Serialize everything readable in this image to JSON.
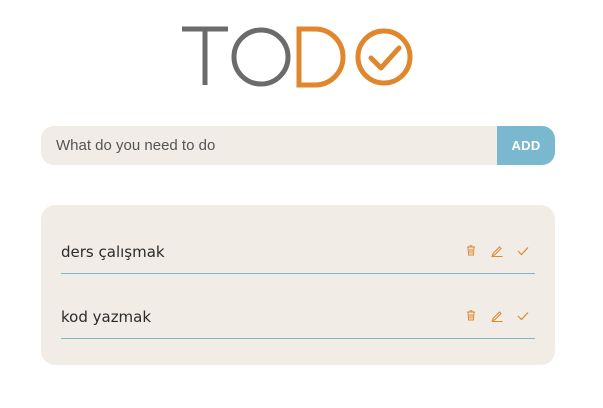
{
  "app": {
    "logo_text": "TODO",
    "accent": "#e0862c",
    "secondary": "#7ab8d0",
    "logo_gray": "#6b6b6b"
  },
  "form": {
    "placeholder": "What do you need to do",
    "value": "",
    "add_label": "ADD"
  },
  "todos": [
    {
      "text": "ders çalışmak",
      "icons": [
        "trash-icon",
        "pencil-icon",
        "check-icon"
      ]
    },
    {
      "text": "kod yazmak",
      "icons": [
        "trash-icon",
        "pencil-icon",
        "check-icon"
      ]
    }
  ]
}
